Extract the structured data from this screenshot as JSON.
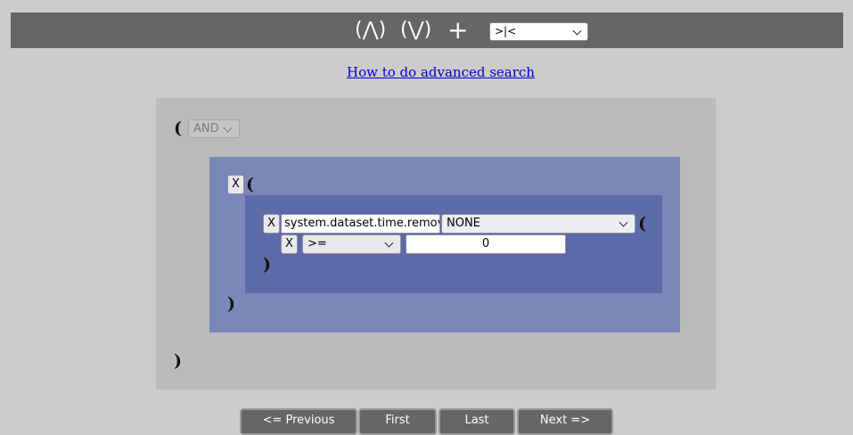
{
  "toolbar": {
    "and_label": "(⋀)",
    "or_label": "(⋁)",
    "add_label": "+",
    "select_value": ">|<"
  },
  "help_link": "How to do advanced search",
  "query": {
    "open_paren": "(",
    "close_paren": ")",
    "operator": "AND",
    "group": {
      "remove_label": "X",
      "open_paren": "(",
      "close_paren": ")",
      "field": {
        "remove_label": "X",
        "name": "system.dataset.time.remove",
        "transform": "NONE",
        "open_paren": "(",
        "close_paren": ")",
        "condition": {
          "remove_label": "X",
          "comparator": ">=",
          "value": "0"
        }
      }
    }
  },
  "pagination": {
    "previous": "<= Previous",
    "first": "First",
    "last": "Last",
    "next": "Next =>"
  }
}
